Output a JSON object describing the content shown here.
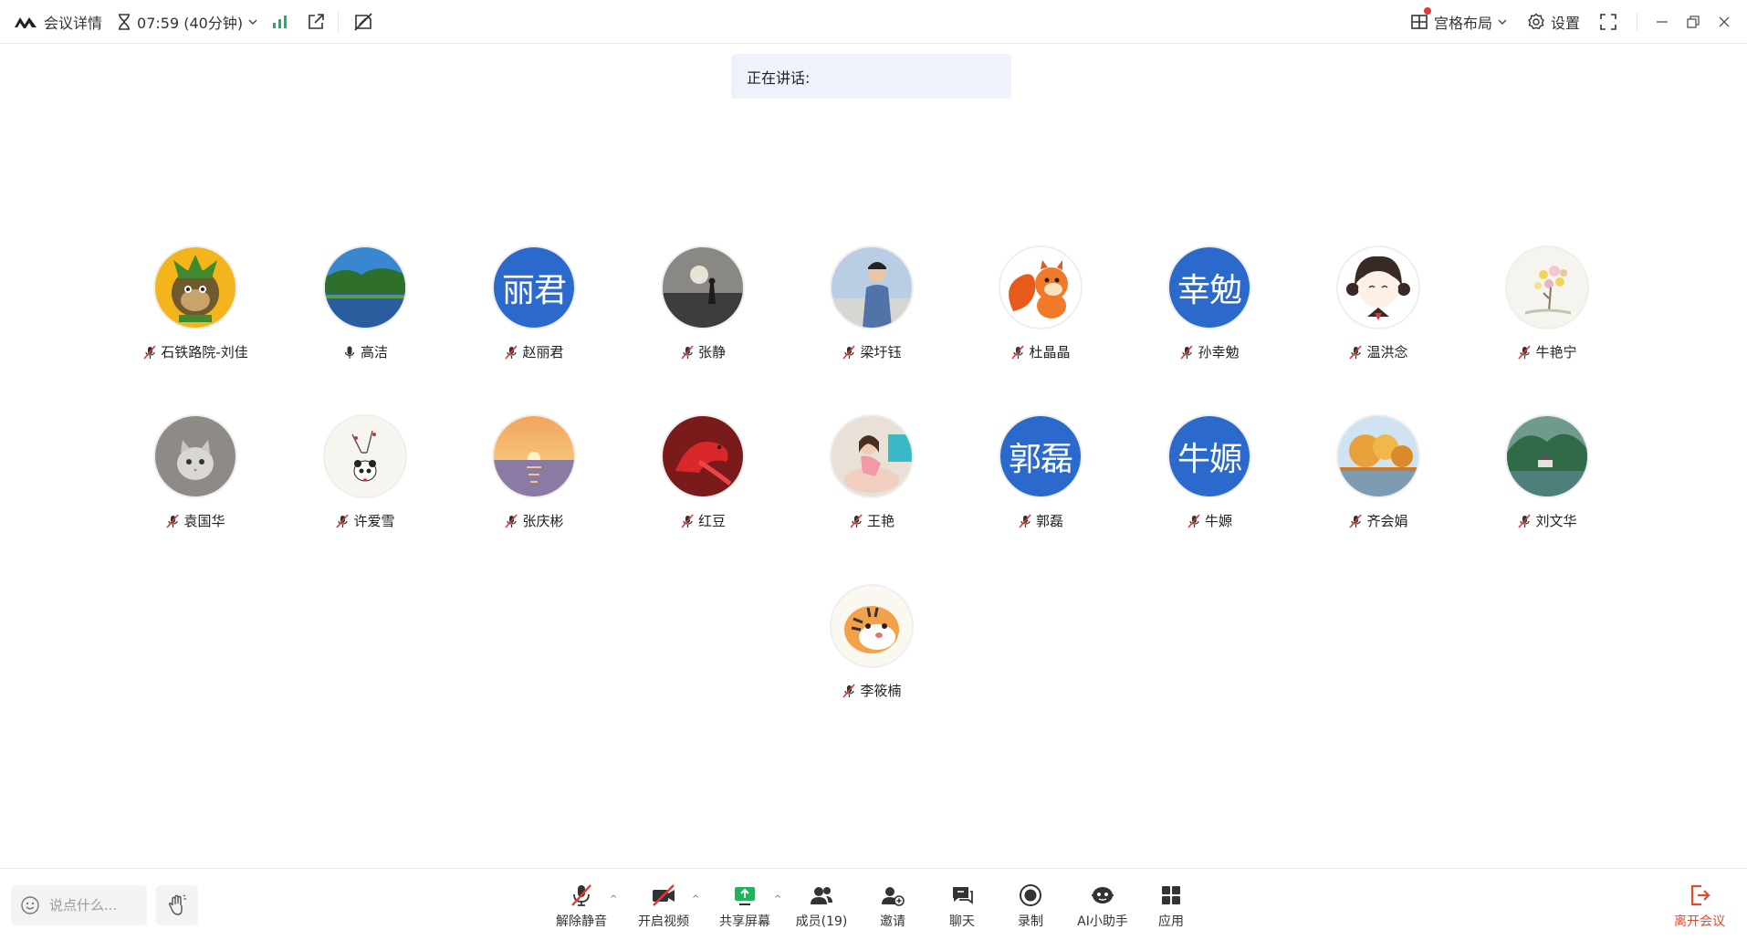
{
  "topbar": {
    "meeting_details": "会议详情",
    "timer": "07:59 (40分钟)",
    "layout_label": "宫格布局",
    "settings_label": "设置"
  },
  "banner": {
    "speaking_label": "正在讲话:"
  },
  "participants": [
    {
      "name": "石铁路院-刘佳",
      "avatar": "monkey-cartoon",
      "mic": "muted"
    },
    {
      "name": "高洁",
      "avatar": "lake-landscape",
      "mic": "on"
    },
    {
      "name": "赵丽君",
      "avatar_text": "丽君",
      "mic": "muted"
    },
    {
      "name": "张静",
      "avatar": "sunset-silhouette",
      "mic": "muted"
    },
    {
      "name": "梁圩钰",
      "avatar": "man-photo",
      "mic": "muted"
    },
    {
      "name": "杜晶晶",
      "avatar": "squirrel-cartoon",
      "mic": "muted"
    },
    {
      "name": "孙幸勉",
      "avatar_text": "幸勉",
      "mic": "muted"
    },
    {
      "name": "温洪念",
      "avatar": "girl-cartoon",
      "mic": "muted"
    },
    {
      "name": "牛艳宁",
      "avatar": "tree-painting",
      "mic": "muted"
    },
    {
      "name": "袁国华",
      "avatar": "cat-photo",
      "mic": "muted"
    },
    {
      "name": "许爱雪",
      "avatar": "panda-painting",
      "mic": "muted"
    },
    {
      "name": "张庆彬",
      "avatar": "sea-sunset",
      "mic": "muted"
    },
    {
      "name": "红豆",
      "avatar": "red-bird",
      "mic": "muted"
    },
    {
      "name": "王艳",
      "avatar": "girl-photo",
      "mic": "muted"
    },
    {
      "name": "郭磊",
      "avatar_text": "郭磊",
      "mic": "muted"
    },
    {
      "name": "牛嫄",
      "avatar_text": "牛嫄",
      "mic": "muted"
    },
    {
      "name": "齐会娟",
      "avatar": "autumn-tree",
      "mic": "muted"
    },
    {
      "name": "刘文华",
      "avatar": "mountain-lake",
      "mic": "muted"
    },
    {
      "name": "李筱楠",
      "avatar": "tiger-cartoon",
      "mic": "muted"
    }
  ],
  "bottombar": {
    "chat_placeholder": "说点什么...",
    "tools": {
      "unmute": "解除静音",
      "start_video": "开启视频",
      "share_screen": "共享屏幕",
      "members": "成员(19)",
      "invite": "邀请",
      "chat": "聊天",
      "record": "录制",
      "ai_assistant": "AI小助手",
      "apps": "应用",
      "leave": "离开会议"
    }
  },
  "colors": {
    "avatar_blue": "#2c69cc",
    "leave_red": "#e04a2f",
    "signal_green": "#21b35c",
    "banner_bg": "#eef2fb"
  }
}
